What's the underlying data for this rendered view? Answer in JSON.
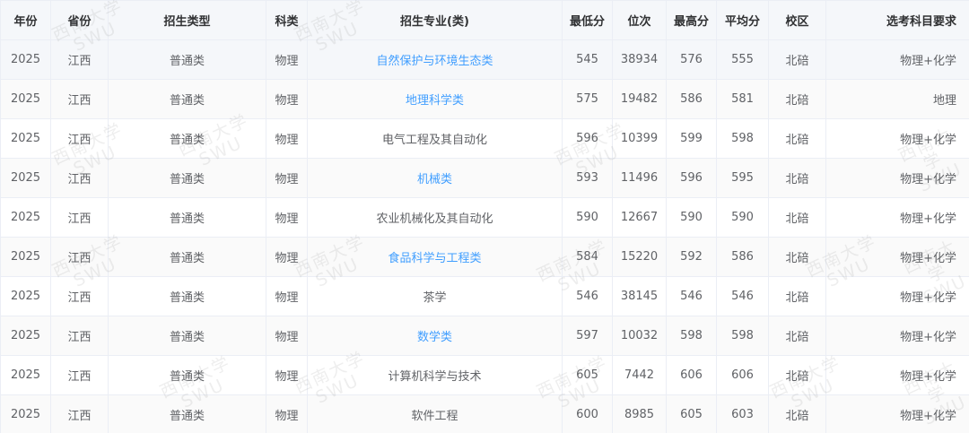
{
  "table": {
    "columns": [
      "年份",
      "省份",
      "招生类型",
      "科类",
      "招生专业(类)",
      "最低分",
      "位次",
      "最高分",
      "平均分",
      "校区",
      "选考科目要求"
    ],
    "rows": [
      [
        "2025",
        "江西",
        "普通类",
        "物理",
        "自然保护与环境生态类",
        "545",
        "38934",
        "576",
        "555",
        "北碚",
        "物理+化学"
      ],
      [
        "2025",
        "江西",
        "普通类",
        "物理",
        "地理科学类",
        "575",
        "19482",
        "586",
        "581",
        "北碚",
        "地理"
      ],
      [
        "2025",
        "江西",
        "普通类",
        "物理",
        "电气工程及其自动化",
        "596",
        "10399",
        "599",
        "598",
        "北碚",
        "物理+化学"
      ],
      [
        "2025",
        "江西",
        "普通类",
        "物理",
        "机械类",
        "593",
        "11496",
        "596",
        "595",
        "北碚",
        "物理+化学"
      ],
      [
        "2025",
        "江西",
        "普通类",
        "物理",
        "农业机械化及其自动化",
        "590",
        "12667",
        "590",
        "590",
        "北碚",
        "物理+化学"
      ],
      [
        "2025",
        "江西",
        "普通类",
        "物理",
        "食品科学与工程类",
        "584",
        "15220",
        "592",
        "586",
        "北碚",
        "物理+化学"
      ],
      [
        "2025",
        "江西",
        "普通类",
        "物理",
        "茶学",
        "546",
        "38145",
        "546",
        "546",
        "北碚",
        "物理+化学"
      ],
      [
        "2025",
        "江西",
        "普通类",
        "物理",
        "数学类",
        "597",
        "10032",
        "598",
        "598",
        "北碚",
        "物理+化学"
      ],
      [
        "2025",
        "江西",
        "普通类",
        "物理",
        "计算机科学与技术",
        "605",
        "7442",
        "606",
        "606",
        "北碚",
        "物理+化学"
      ],
      [
        "2025",
        "江西",
        "普通类",
        "物理",
        "软件工程",
        "600",
        "8985",
        "605",
        "603",
        "北碚",
        "物理+化学"
      ]
    ],
    "linked_majors": [
      true,
      true,
      false,
      true,
      false,
      true,
      false,
      true,
      false,
      false
    ]
  },
  "watermark": {
    "line1": "西南大学",
    "line2": "SWU"
  },
  "colors": {
    "header_bg": "#f5f7fa",
    "link": "#409eff",
    "border": "#ebeef5",
    "text": "#606266"
  }
}
